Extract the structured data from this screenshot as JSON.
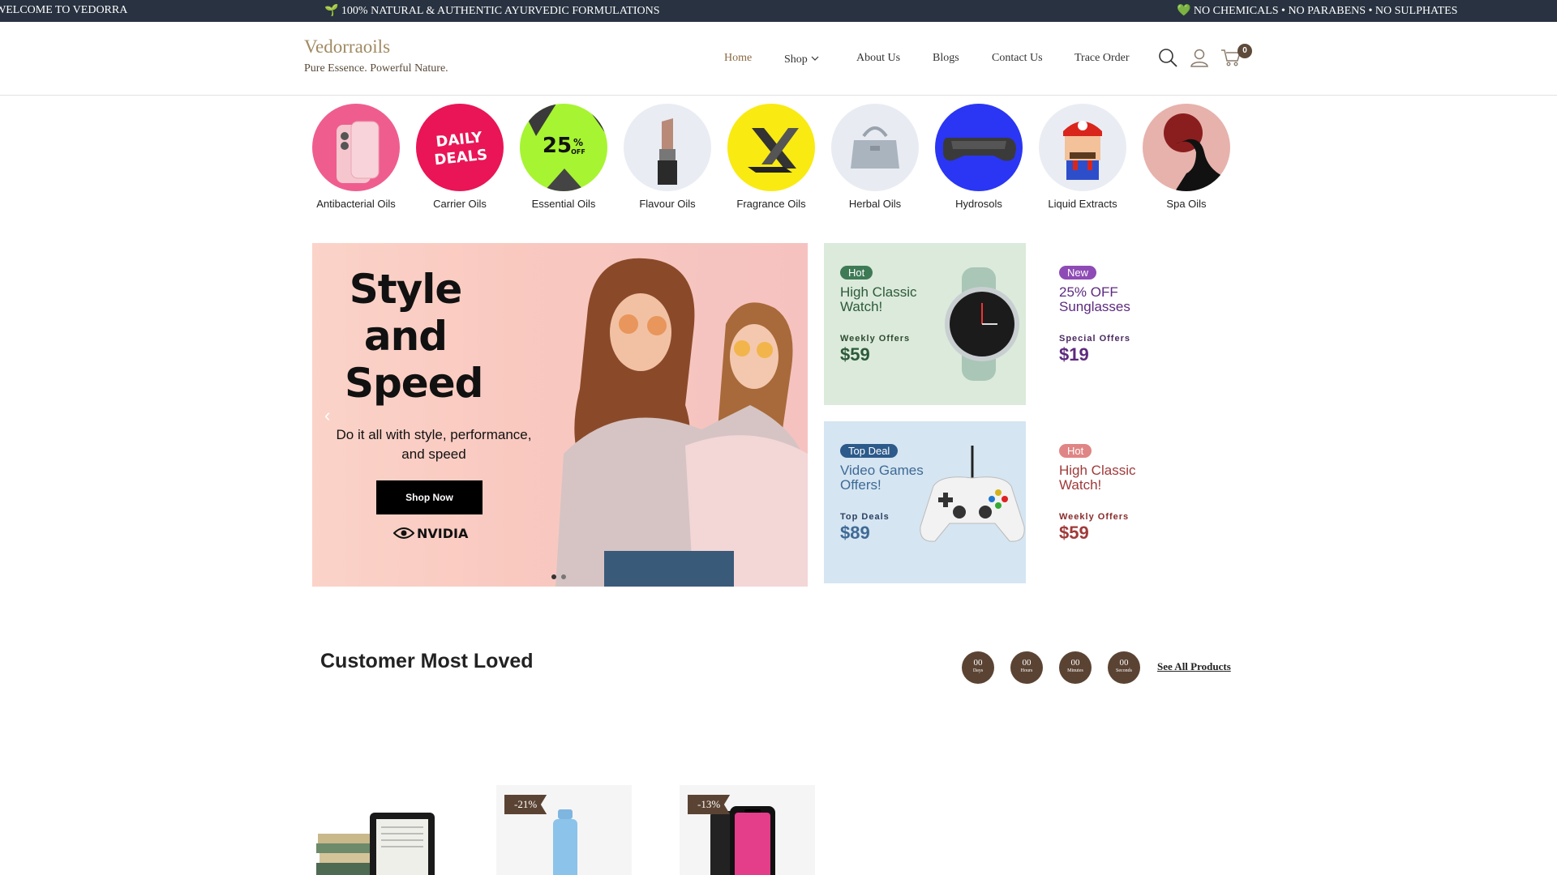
{
  "announcement": {
    "left": "WELCOME TO VEDORRA",
    "middle": "🌱 100% NATURAL & AUTHENTIC AYURVEDIC FORMULATIONS",
    "right": "💚 NO CHEMICALS • NO PARABENS • NO SULPHATES"
  },
  "header": {
    "logo": "Vedorraoils",
    "tagline": "Pure Essence. Powerful Nature.",
    "nav": [
      "Home",
      "Shop",
      "About Us",
      "Blogs",
      "Contact Us",
      "Trace Order"
    ],
    "cart_count": "0",
    "icons": [
      "search-icon",
      "user-icon",
      "cart-icon"
    ]
  },
  "categories": [
    "Antibacterial Oils",
    "Carrier Oils",
    "Essential Oils",
    "Flavour Oils",
    "Fragrance Oils",
    "Herbal Oils",
    "Hydrosols",
    "Liquid Extracts",
    "Spa Oils"
  ],
  "category_art": {
    "daily_deals": "DAILY DEALS",
    "percent": "25",
    "percent_sign": "%",
    "off": "OFF"
  },
  "hero": {
    "title": "Style and Speed",
    "subtitle": "Do it all with style, performance, and speed",
    "button": "Shop Now",
    "brand": "NVIDIA"
  },
  "promos": [
    {
      "badge": "Hot",
      "title": "High Classic Watch!",
      "offer": "Weekly Offers",
      "price": "$59"
    },
    {
      "badge": "New",
      "title": "25% OFF Sunglasses",
      "offer": "Special Offers",
      "price": "$19"
    },
    {
      "badge": "Top Deal",
      "title": "Video Games Offers!",
      "offer": "Top Deals",
      "price": "$89"
    },
    {
      "badge": "Hot",
      "title": "High Classic Watch!",
      "offer": "Weekly Offers",
      "price": "$59"
    }
  ],
  "section": {
    "title": "Customer Most Loved",
    "see_all": "See All Products",
    "timer": [
      {
        "value": "00",
        "unit": "Days"
      },
      {
        "value": "00",
        "unit": "Hours"
      },
      {
        "value": "00",
        "unit": "Minutes"
      },
      {
        "value": "00",
        "unit": "Seconds"
      }
    ]
  },
  "products": [
    {
      "discount": ""
    },
    {
      "discount": "-21%"
    },
    {
      "discount": "-13%"
    }
  ],
  "colors": {
    "announce_bg": "#283240",
    "accent_brown": "#5b4333",
    "nav_active": "#8a6a44"
  }
}
